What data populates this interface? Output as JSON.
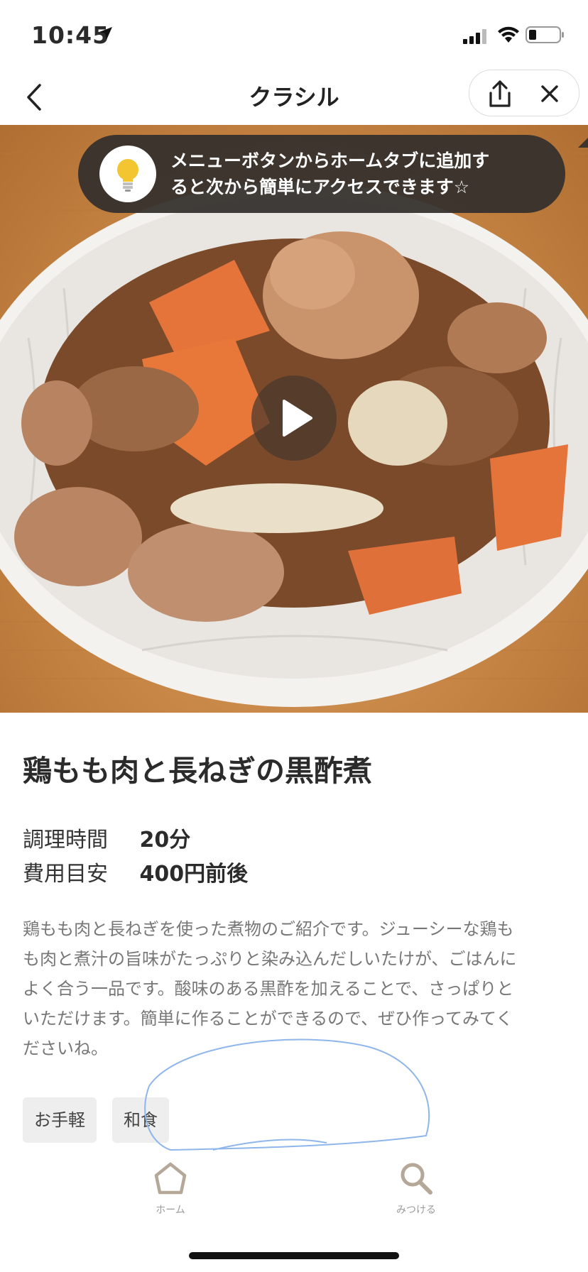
{
  "status_bar": {
    "time": "10:45"
  },
  "nav": {
    "title": "クラシル"
  },
  "tooltip": {
    "line1": "メニューボタンからホームタブに追加す",
    "line2": "ると次から簡単にアクセスできます☆"
  },
  "recipe": {
    "title": "鶏もも肉と長ねぎの黒酢煮",
    "info": [
      {
        "label": "調理時間",
        "value": "20分"
      },
      {
        "label": "費用目安",
        "value": "400円前後"
      }
    ],
    "description": [
      "鶏もも肉と長ねぎを使った煮物のご紹介です。ジューシーな鶏も",
      "も肉と煮汁の旨味がたっぷりと染み込んだしいたけが、ごはんに",
      "よく合う一品です。酸味のある黒酢を加えることで、さっぱりと",
      "いただけます。簡単に作ることができるので、ぜひ作ってみてく",
      "ださいね。"
    ],
    "tags": [
      "お手軽",
      "和食"
    ]
  },
  "tab_bar": {
    "home_label": "ホーム",
    "search_label": "みつける"
  },
  "icons": {
    "back": "chevron-left-icon",
    "share": "share-icon",
    "close": "close-icon",
    "bulb": "lightbulb-icon",
    "play": "play-icon",
    "home": "home-icon",
    "search": "search-icon"
  },
  "colors": {
    "tooltip_bg": "#34302d",
    "tab_icon": "#b5a898",
    "tag_bg": "#eeeeee"
  }
}
